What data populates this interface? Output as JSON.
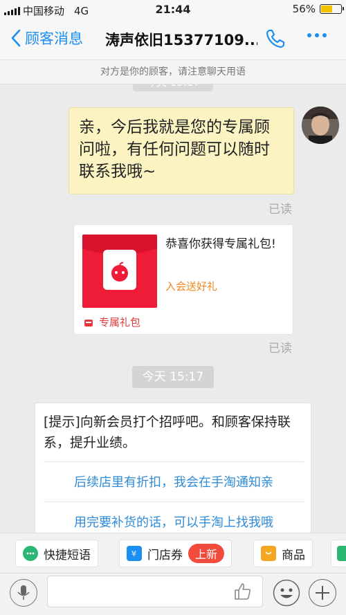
{
  "status": {
    "carrier": "中国移动",
    "network": "4G",
    "time": "21:44",
    "battery": "56%",
    "battery_level": 0.56
  },
  "nav": {
    "back_label": "顾客消息",
    "title": "涛声依旧15377109..."
  },
  "notice": "对方是你的顾客，请注意聊天用语",
  "chat": {
    "clipped_timestamp": "今天 15:17",
    "message_text": "亲，今后我就是您的专属顾问啦，有任何问题可以随时联系我哦~",
    "read_1": "已读",
    "gift": {
      "title": "恭喜你获得专属礼包!",
      "subtitle": "入会送好礼",
      "footer": "专属礼包"
    },
    "read_2": "已读",
    "timestamp": "今天 15:17",
    "tip": {
      "text": "[提示]向新会员打个招呼吧。和顾客保持联系，提升业绩。",
      "option_1": "后续店里有折扣，我会在手淘通知亲",
      "option_2": "用完要补货的话，可以手淘上找我哦"
    }
  },
  "quickbar": {
    "sms": "快捷短语",
    "coupon": "门店券",
    "new_badge": "上新",
    "goods": "商品"
  },
  "colors": {
    "accent": "#1a8ef2",
    "bubble": "#fbf3c2",
    "gift_red": "#ef1c38",
    "link": "#2f8bd8"
  }
}
